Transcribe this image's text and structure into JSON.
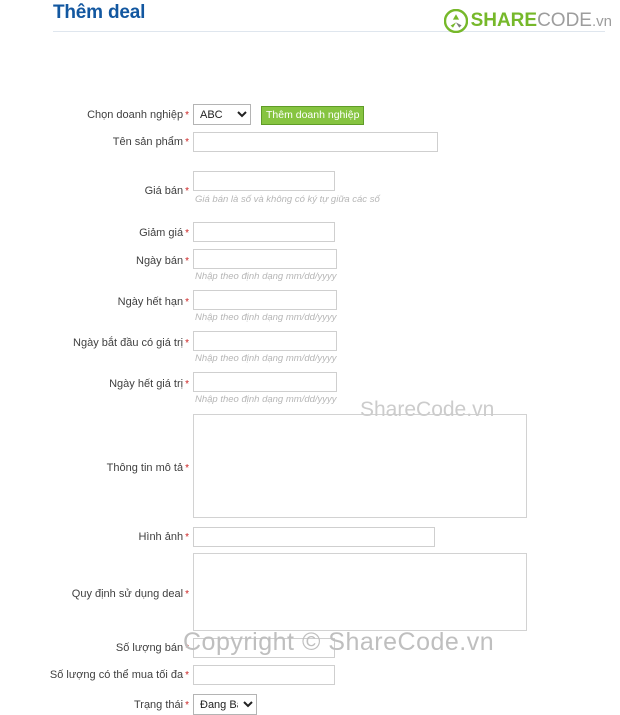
{
  "header": {
    "title": "Thêm deal",
    "logo": {
      "icon": "recycle-logo-icon",
      "part1": "SHARE",
      "part2": "CODE",
      "part3": ".vn",
      "green": "#76b82a",
      "gray": "#9d9d9d"
    }
  },
  "watermarks": {
    "center": "ShareCode.vn",
    "bottom": "Copyright © ShareCode.vn"
  },
  "form": {
    "required_marker": "*",
    "company": {
      "label": "Chọn doanh nghiệp",
      "selected": "ABC",
      "options": [
        "ABC"
      ],
      "add_button": "Thêm doanh nghiệp"
    },
    "product_name": {
      "label": "Tên sản phẩm",
      "value": "",
      "placeholder": ""
    },
    "price": {
      "label": "Giá bán",
      "value": "",
      "hint": "Giá bán là số và không có ký tự giữa các số"
    },
    "discount": {
      "label": "Giảm giá",
      "value": ""
    },
    "sale_date": {
      "label": "Ngày bán",
      "value": "",
      "hint": "Nhập theo định dạng mm/dd/yyyy"
    },
    "expiry_date": {
      "label": "Ngày hết hạn",
      "value": "",
      "hint": "Nhập theo định dạng mm/dd/yyyy"
    },
    "valid_from": {
      "label": "Ngày bắt đầu có giá trị",
      "value": "",
      "hint": "Nhập theo định dạng mm/dd/yyyy"
    },
    "valid_to": {
      "label": "Ngày hết giá trị",
      "value": "",
      "hint": "Nhập theo định dạng mm/dd/yyyy"
    },
    "description": {
      "label": "Thông tin mô tả",
      "value": ""
    },
    "image": {
      "label": "Hình ảnh",
      "value": ""
    },
    "terms": {
      "label": "Quy định sử dụng deal",
      "value": ""
    },
    "quantity": {
      "label": "Số lượng bán",
      "value": ""
    },
    "max_per_buyer": {
      "label": "Số lượng có thể mua tối đa",
      "value": ""
    },
    "status": {
      "label": "Trạng thái",
      "selected": "Đang Bán",
      "options": [
        "Đang Bán"
      ]
    }
  }
}
